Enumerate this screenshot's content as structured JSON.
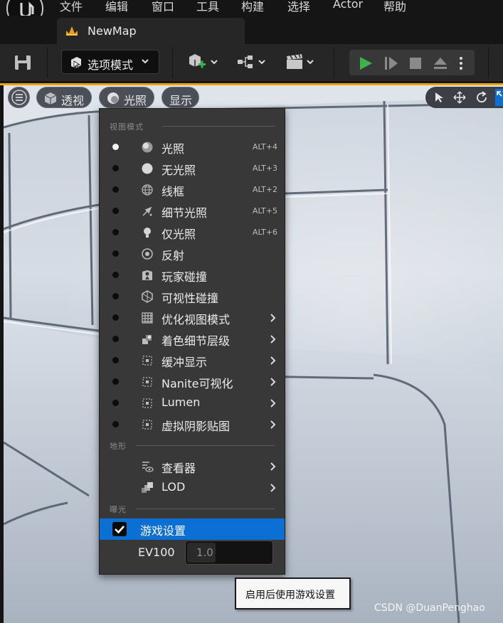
{
  "menubar": {
    "items": [
      "文件",
      "编辑",
      "窗口",
      "工具",
      "构建",
      "选择",
      "Actor",
      "帮助"
    ]
  },
  "tab": {
    "title": "NewMap",
    "icon": "level-map-icon"
  },
  "toolbar": {
    "mode_label": "选项模式",
    "icons": [
      "save-icon",
      "select-mode-icon",
      "add-actor-icon",
      "blueprint-icon",
      "cinematics-icon",
      "play-icon",
      "advance-frame-icon",
      "stop-icon",
      "eject-icon",
      "more-options-icon"
    ]
  },
  "viewport": {
    "perspective_label": "透视",
    "lighting_label": "光照",
    "show_label": "显示"
  },
  "view_menu": {
    "section_view_mode": "视图模式",
    "section_landscape": "地形",
    "section_exposure": "曝光",
    "view_modes": [
      {
        "label": "光照",
        "shortcut": "ALT+4",
        "selected": true,
        "submenu": false,
        "icon": "lit-sphere-icon"
      },
      {
        "label": "无光照",
        "shortcut": "ALT+3",
        "selected": false,
        "submenu": false,
        "icon": "unlit-sphere-icon"
      },
      {
        "label": "线框",
        "shortcut": "ALT+2",
        "selected": false,
        "submenu": false,
        "icon": "wireframe-sphere-icon"
      },
      {
        "label": "细节光照",
        "shortcut": "ALT+5",
        "selected": false,
        "submenu": false,
        "icon": "detail-lighting-icon"
      },
      {
        "label": "仅光照",
        "shortcut": "ALT+6",
        "selected": false,
        "submenu": false,
        "icon": "lightbulb-icon"
      },
      {
        "label": "反射",
        "shortcut": "",
        "selected": false,
        "submenu": false,
        "icon": "reflection-icon"
      },
      {
        "label": "玩家碰撞",
        "shortcut": "",
        "selected": false,
        "submenu": false,
        "icon": "player-collision-icon"
      },
      {
        "label": "可视性碰撞",
        "shortcut": "",
        "selected": false,
        "submenu": false,
        "icon": "visibility-collision-icon"
      },
      {
        "label": "优化视图模式",
        "shortcut": "",
        "selected": false,
        "submenu": true,
        "icon": "optimization-grid-icon"
      },
      {
        "label": "着色细节层级",
        "shortcut": "",
        "selected": false,
        "submenu": true,
        "icon": "lod-coloration-icon"
      },
      {
        "label": "缓冲显示",
        "shortcut": "",
        "selected": false,
        "submenu": true,
        "icon": "buffer-icon"
      },
      {
        "label": "Nanite可视化",
        "shortcut": "",
        "selected": false,
        "submenu": true,
        "icon": "nanite-icon"
      },
      {
        "label": "Lumen",
        "shortcut": "",
        "selected": false,
        "submenu": true,
        "icon": "lumen-icon"
      },
      {
        "label": "虚拟阴影贴图",
        "shortcut": "",
        "selected": false,
        "submenu": true,
        "icon": "virtual-shadow-map-icon"
      }
    ],
    "landscape_items": [
      {
        "label": "查看器",
        "icon": "visualizer-icon"
      },
      {
        "label": "LOD",
        "icon": "lod-icon"
      }
    ],
    "game_settings": {
      "label": "游戏设置",
      "checked": true
    },
    "ev100": {
      "label": "EV100",
      "value": "1.0"
    }
  },
  "tooltip": "启用后使用游戏设置",
  "watermark": "CSDN @DuanPenghao",
  "colors": {
    "accent_blue": "#0b6fd3",
    "play_green": "#3bb34a",
    "viewport_frame": "#f0a10c"
  }
}
